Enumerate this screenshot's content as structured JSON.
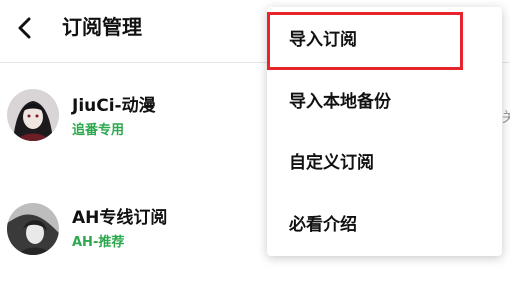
{
  "header": {
    "title": "订阅管理",
    "back_icon": "back-arrow-icon"
  },
  "subscriptions": [
    {
      "name": "JiuCi-动漫",
      "tag": "追番专用",
      "avatar": "anime-character-avatar"
    },
    {
      "name": "AH专线订阅",
      "tag": "AH-推荐",
      "avatar": "grayscale-character-avatar"
    }
  ],
  "edge_glyph": "关",
  "menu": {
    "items": [
      {
        "label": "导入订阅",
        "highlighted": true
      },
      {
        "label": "导入本地备份"
      },
      {
        "label": "自定义订阅"
      },
      {
        "label": "必看介绍"
      }
    ]
  },
  "colors": {
    "tag_green": "#2ea84f",
    "highlight_red": "#e8242c"
  }
}
